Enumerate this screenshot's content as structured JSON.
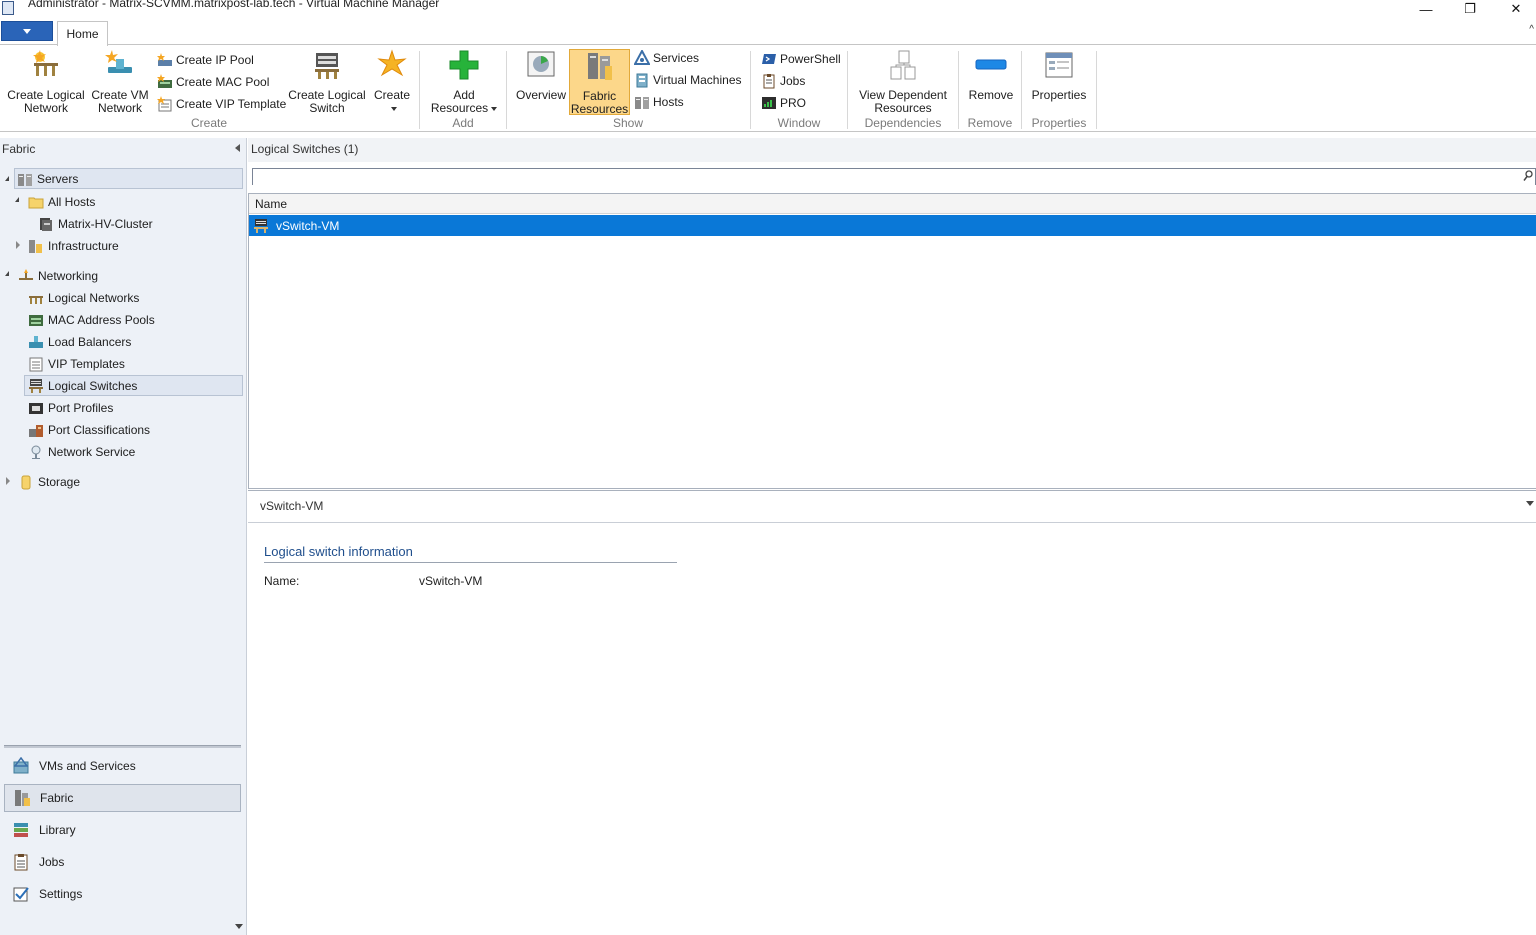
{
  "window": {
    "title": "Administrator - Matrix-SCVMM.matrixpost-lab.tech - Virtual Machine Manager",
    "minimize": "—",
    "restore": "❐",
    "close": "✕"
  },
  "tabs": [
    {
      "label": "Home",
      "active": true
    }
  ],
  "ribbon": {
    "groups": {
      "create": "Create",
      "add": "Add",
      "show": "Show",
      "window": "Window",
      "dependencies": "Dependencies",
      "remove": "Remove",
      "properties": "Properties"
    },
    "buttons": {
      "create_logical_network": "Create Logical Network",
      "create_vm_network": "Create VM Network",
      "create_ip_pool": "Create IP Pool",
      "create_mac_pool": "Create MAC Pool",
      "create_vip_template": "Create VIP Template",
      "create_logical_switch": "Create Logical Switch",
      "create": "Create",
      "add_resources": "Add Resources",
      "overview": "Overview",
      "fabric_resources": "Fabric Resources",
      "services": "Services",
      "virtual_machines": "Virtual Machines",
      "hosts": "Hosts",
      "powershell": "PowerShell",
      "jobs": "Jobs",
      "pro": "PRO",
      "view_dependent_resources": "View Dependent Resources",
      "remove": "Remove",
      "properties": "Properties"
    }
  },
  "nav": {
    "title": "Fabric",
    "tree": {
      "servers": "Servers",
      "all_hosts": "All Hosts",
      "cluster": "Matrix-HV-Cluster",
      "infrastructure": "Infrastructure",
      "networking": "Networking",
      "logical_networks": "Logical Networks",
      "mac_address_pools": "MAC Address Pools",
      "load_balancers": "Load Balancers",
      "vip_templates": "VIP Templates",
      "logical_switches": "Logical Switches",
      "port_profiles": "Port Profiles",
      "port_classifications": "Port Classifications",
      "network_service": "Network Service",
      "storage": "Storage"
    },
    "workspaces": {
      "vms_and_services": "VMs and Services",
      "fabric": "Fabric",
      "library": "Library",
      "jobs": "Jobs",
      "settings": "Settings"
    }
  },
  "main": {
    "list_title": "Logical Switches (1)",
    "search": {
      "value": "",
      "placeholder": ""
    },
    "columns": [
      "Name"
    ],
    "rows": [
      {
        "name": "vSwitch-VM",
        "selected": true
      }
    ]
  },
  "details": {
    "title": "vSwitch-VM",
    "section": "Logical switch information",
    "name_label": "Name:",
    "name_value": "vSwitch-VM"
  },
  "colors": {
    "selection": "#0a78d7",
    "ribbon_active": "#fcd78a",
    "nav_bg": "#edf1f7",
    "section_heading": "#1f4e8c"
  }
}
